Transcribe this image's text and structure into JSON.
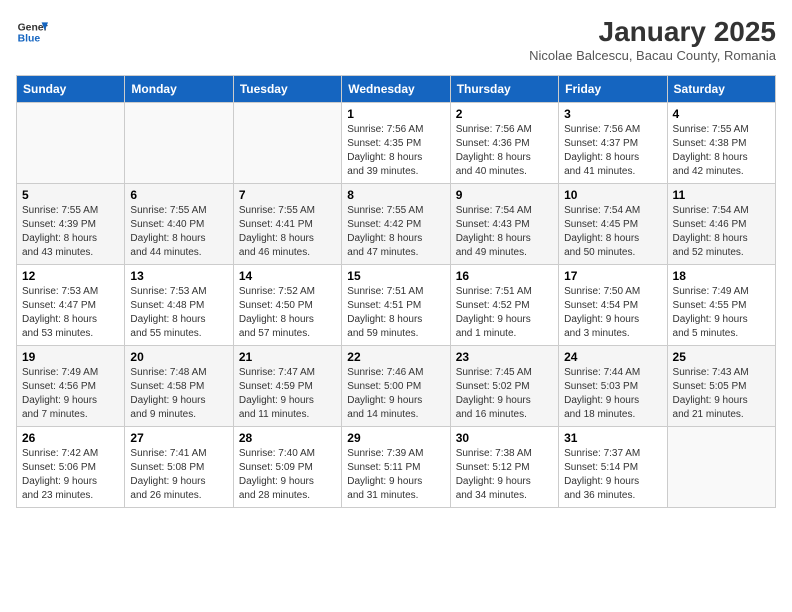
{
  "header": {
    "logo_line1": "General",
    "logo_line2": "Blue",
    "month": "January 2025",
    "location": "Nicolae Balcescu, Bacau County, Romania"
  },
  "weekdays": [
    "Sunday",
    "Monday",
    "Tuesday",
    "Wednesday",
    "Thursday",
    "Friday",
    "Saturday"
  ],
  "weeks": [
    [
      {
        "day": "",
        "info": ""
      },
      {
        "day": "",
        "info": ""
      },
      {
        "day": "",
        "info": ""
      },
      {
        "day": "1",
        "info": "Sunrise: 7:56 AM\nSunset: 4:35 PM\nDaylight: 8 hours\nand 39 minutes."
      },
      {
        "day": "2",
        "info": "Sunrise: 7:56 AM\nSunset: 4:36 PM\nDaylight: 8 hours\nand 40 minutes."
      },
      {
        "day": "3",
        "info": "Sunrise: 7:56 AM\nSunset: 4:37 PM\nDaylight: 8 hours\nand 41 minutes."
      },
      {
        "day": "4",
        "info": "Sunrise: 7:55 AM\nSunset: 4:38 PM\nDaylight: 8 hours\nand 42 minutes."
      }
    ],
    [
      {
        "day": "5",
        "info": "Sunrise: 7:55 AM\nSunset: 4:39 PM\nDaylight: 8 hours\nand 43 minutes."
      },
      {
        "day": "6",
        "info": "Sunrise: 7:55 AM\nSunset: 4:40 PM\nDaylight: 8 hours\nand 44 minutes."
      },
      {
        "day": "7",
        "info": "Sunrise: 7:55 AM\nSunset: 4:41 PM\nDaylight: 8 hours\nand 46 minutes."
      },
      {
        "day": "8",
        "info": "Sunrise: 7:55 AM\nSunset: 4:42 PM\nDaylight: 8 hours\nand 47 minutes."
      },
      {
        "day": "9",
        "info": "Sunrise: 7:54 AM\nSunset: 4:43 PM\nDaylight: 8 hours\nand 49 minutes."
      },
      {
        "day": "10",
        "info": "Sunrise: 7:54 AM\nSunset: 4:45 PM\nDaylight: 8 hours\nand 50 minutes."
      },
      {
        "day": "11",
        "info": "Sunrise: 7:54 AM\nSunset: 4:46 PM\nDaylight: 8 hours\nand 52 minutes."
      }
    ],
    [
      {
        "day": "12",
        "info": "Sunrise: 7:53 AM\nSunset: 4:47 PM\nDaylight: 8 hours\nand 53 minutes."
      },
      {
        "day": "13",
        "info": "Sunrise: 7:53 AM\nSunset: 4:48 PM\nDaylight: 8 hours\nand 55 minutes."
      },
      {
        "day": "14",
        "info": "Sunrise: 7:52 AM\nSunset: 4:50 PM\nDaylight: 8 hours\nand 57 minutes."
      },
      {
        "day": "15",
        "info": "Sunrise: 7:51 AM\nSunset: 4:51 PM\nDaylight: 8 hours\nand 59 minutes."
      },
      {
        "day": "16",
        "info": "Sunrise: 7:51 AM\nSunset: 4:52 PM\nDaylight: 9 hours\nand 1 minute."
      },
      {
        "day": "17",
        "info": "Sunrise: 7:50 AM\nSunset: 4:54 PM\nDaylight: 9 hours\nand 3 minutes."
      },
      {
        "day": "18",
        "info": "Sunrise: 7:49 AM\nSunset: 4:55 PM\nDaylight: 9 hours\nand 5 minutes."
      }
    ],
    [
      {
        "day": "19",
        "info": "Sunrise: 7:49 AM\nSunset: 4:56 PM\nDaylight: 9 hours\nand 7 minutes."
      },
      {
        "day": "20",
        "info": "Sunrise: 7:48 AM\nSunset: 4:58 PM\nDaylight: 9 hours\nand 9 minutes."
      },
      {
        "day": "21",
        "info": "Sunrise: 7:47 AM\nSunset: 4:59 PM\nDaylight: 9 hours\nand 11 minutes."
      },
      {
        "day": "22",
        "info": "Sunrise: 7:46 AM\nSunset: 5:00 PM\nDaylight: 9 hours\nand 14 minutes."
      },
      {
        "day": "23",
        "info": "Sunrise: 7:45 AM\nSunset: 5:02 PM\nDaylight: 9 hours\nand 16 minutes."
      },
      {
        "day": "24",
        "info": "Sunrise: 7:44 AM\nSunset: 5:03 PM\nDaylight: 9 hours\nand 18 minutes."
      },
      {
        "day": "25",
        "info": "Sunrise: 7:43 AM\nSunset: 5:05 PM\nDaylight: 9 hours\nand 21 minutes."
      }
    ],
    [
      {
        "day": "26",
        "info": "Sunrise: 7:42 AM\nSunset: 5:06 PM\nDaylight: 9 hours\nand 23 minutes."
      },
      {
        "day": "27",
        "info": "Sunrise: 7:41 AM\nSunset: 5:08 PM\nDaylight: 9 hours\nand 26 minutes."
      },
      {
        "day": "28",
        "info": "Sunrise: 7:40 AM\nSunset: 5:09 PM\nDaylight: 9 hours\nand 28 minutes."
      },
      {
        "day": "29",
        "info": "Sunrise: 7:39 AM\nSunset: 5:11 PM\nDaylight: 9 hours\nand 31 minutes."
      },
      {
        "day": "30",
        "info": "Sunrise: 7:38 AM\nSunset: 5:12 PM\nDaylight: 9 hours\nand 34 minutes."
      },
      {
        "day": "31",
        "info": "Sunrise: 7:37 AM\nSunset: 5:14 PM\nDaylight: 9 hours\nand 36 minutes."
      },
      {
        "day": "",
        "info": ""
      }
    ]
  ]
}
